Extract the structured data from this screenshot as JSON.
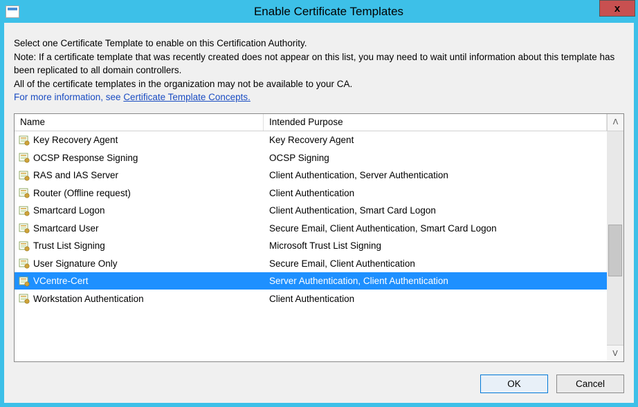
{
  "window": {
    "title": "Enable Certificate Templates",
    "close_glyph": "x"
  },
  "instructions": {
    "line1": "Select one Certificate Template to enable on this Certification Authority.",
    "line2": "Note: If a certificate template that was recently created does not appear on this list, you may need to wait until information about this template has been replicated to all domain controllers.",
    "line3": "All of the certificate templates in the organization may not be available to your CA.",
    "link_prefix": "For more information, see ",
    "link_text": "Certificate Template Concepts."
  },
  "columns": {
    "name": "Name",
    "purpose": "Intended Purpose"
  },
  "rows": [
    {
      "name": "Key Recovery Agent",
      "purpose": "Key Recovery Agent",
      "selected": false
    },
    {
      "name": "OCSP Response Signing",
      "purpose": "OCSP Signing",
      "selected": false
    },
    {
      "name": "RAS and IAS Server",
      "purpose": "Client Authentication, Server Authentication",
      "selected": false
    },
    {
      "name": "Router (Offline request)",
      "purpose": "Client Authentication",
      "selected": false
    },
    {
      "name": "Smartcard Logon",
      "purpose": "Client Authentication, Smart Card Logon",
      "selected": false
    },
    {
      "name": "Smartcard User",
      "purpose": "Secure Email, Client Authentication, Smart Card Logon",
      "selected": false
    },
    {
      "name": "Trust List Signing",
      "purpose": "Microsoft Trust List Signing",
      "selected": false
    },
    {
      "name": "User Signature Only",
      "purpose": "Secure Email, Client Authentication",
      "selected": false
    },
    {
      "name": "VCentre-Cert",
      "purpose": "Server Authentication, Client Authentication",
      "selected": true
    },
    {
      "name": "Workstation Authentication",
      "purpose": "Client Authentication",
      "selected": false
    }
  ],
  "buttons": {
    "ok": "OK",
    "cancel": "Cancel"
  },
  "glyphs": {
    "up": "ᐱ",
    "down": "ᐯ"
  }
}
